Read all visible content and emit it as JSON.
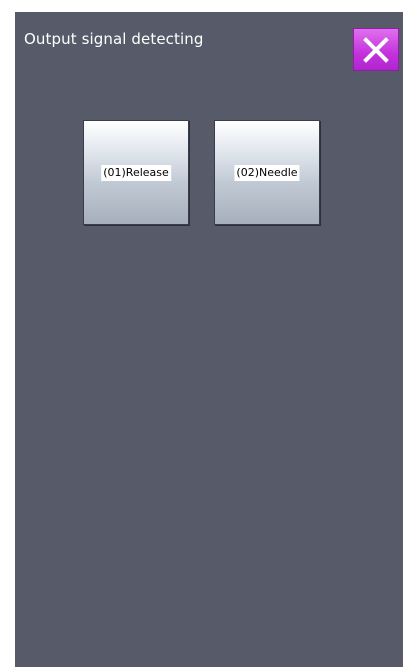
{
  "header": {
    "title": "Output signal detecting",
    "close_icon": "close-x-icon"
  },
  "signals": [
    {
      "label": "(01)Release"
    },
    {
      "label": "(02)Needle"
    }
  ],
  "colors": {
    "background": "#575a69",
    "close_button": "#c332dc",
    "button_face": "#c1c9d4",
    "title_text": "#ffffff"
  }
}
